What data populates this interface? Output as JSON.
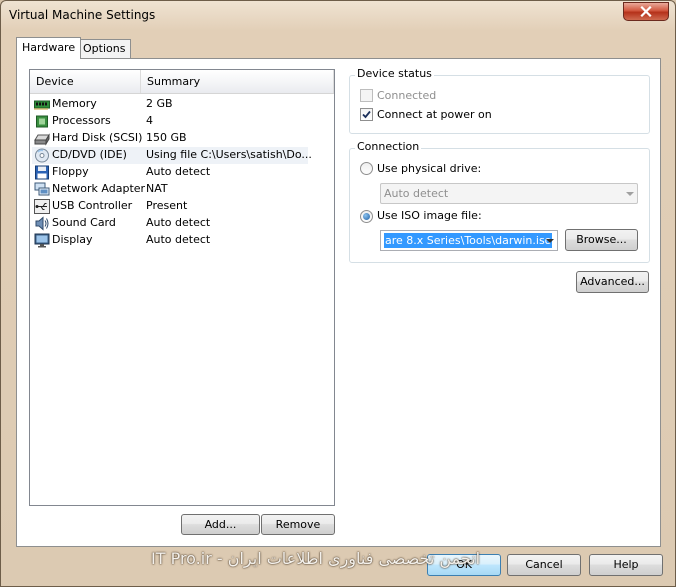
{
  "window": {
    "title": "Virtual Machine Settings"
  },
  "tabs": [
    {
      "label": "Hardware",
      "active": true
    },
    {
      "label": "Options",
      "active": false
    }
  ],
  "device_list": {
    "columns": [
      "Device",
      "Summary"
    ],
    "rows": [
      {
        "icon": "memory-icon",
        "device": "Memory",
        "summary": "2 GB"
      },
      {
        "icon": "processor-icon",
        "device": "Processors",
        "summary": "4"
      },
      {
        "icon": "hard-disk-icon",
        "device": "Hard Disk (SCSI)",
        "summary": "150 GB"
      },
      {
        "icon": "cd-dvd-icon",
        "device": "CD/DVD (IDE)",
        "summary": "Using file C:\\Users\\satish\\Do...",
        "selected": true
      },
      {
        "icon": "floppy-icon",
        "device": "Floppy",
        "summary": "Auto detect"
      },
      {
        "icon": "network-adapter-icon",
        "device": "Network Adapter",
        "summary": "NAT"
      },
      {
        "icon": "usb-icon",
        "device": "USB Controller",
        "summary": "Present"
      },
      {
        "icon": "sound-card-icon",
        "device": "Sound Card",
        "summary": "Auto detect"
      },
      {
        "icon": "display-icon",
        "device": "Display",
        "summary": "Auto detect"
      }
    ],
    "add_label": "Add...",
    "remove_label": "Remove"
  },
  "device_status": {
    "title": "Device status",
    "connected_label": "Connected",
    "connected_checked": false,
    "connect_power_on_label": "Connect at power on",
    "connect_power_on_checked": true
  },
  "connection": {
    "title": "Connection",
    "physical_drive_label": "Use physical drive:",
    "physical_drive_value": "Auto detect",
    "iso_label": "Use ISO image file:",
    "iso_value": "are 8.x Series\\Tools\\darwin.iso",
    "browse_label": "Browse...",
    "selected": "iso"
  },
  "advanced_label": "Advanced...",
  "footer": {
    "ok_label": "OK",
    "cancel_label": "Cancel",
    "help_label": "Help"
  },
  "watermark": "IT Pro.ir - انجمن تخصصی فناوری اطلاعات ایران",
  "colors": {
    "selection": "#3399ff",
    "close_button": "#c44a32"
  }
}
